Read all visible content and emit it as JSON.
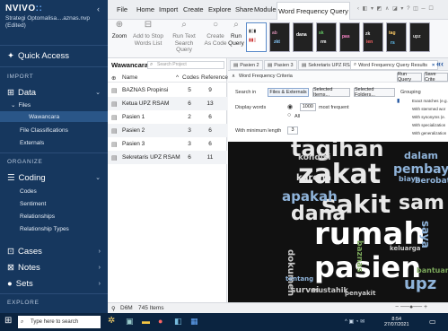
{
  "sidebar": {
    "logo": "NVIVO",
    "logo_mark": "::",
    "project": "Strategi Optomalisa....aznas.nvp",
    "project_state": "(Edited)",
    "quick_access": "Quick Access",
    "import_heading": "IMPORT",
    "data": "Data",
    "files": "Files",
    "wawancara": "Wawancara",
    "file_classifications": "File Classifications",
    "externals": "Externals",
    "organize_heading": "ORGANIZE",
    "coding": "Coding",
    "codes": "Codes",
    "sentiment": "Sentiment",
    "relationships": "Relationships",
    "relationship_types": "Relationship Types",
    "cases": "Cases",
    "notes": "Notes",
    "sets": "Sets",
    "explore_heading": "EXPLORE"
  },
  "menu": [
    "File",
    "Home",
    "Import",
    "Create",
    "Explore",
    "Share",
    "Modules"
  ],
  "active_tab": "Word Frequency Query",
  "ribbon": {
    "zoom": "Zoom",
    "add_stop": [
      "Add to Stop",
      "Words List"
    ],
    "run_text": [
      "Run Text",
      "Search Query"
    ],
    "create_code": [
      "Create",
      "As Code"
    ],
    "run_query": [
      "Run",
      "Query"
    ]
  },
  "list": {
    "title": "Wawancara",
    "search_placeholder": "Search Project",
    "col_name": "Name",
    "col_codes": "Codes",
    "col_refs": "References",
    "rows": [
      {
        "name": "BAZNAS Propinsi",
        "codes": "5",
        "refs": "9"
      },
      {
        "name": "Ketua UPZ RSAM",
        "codes": "6",
        "refs": "13"
      },
      {
        "name": "Pasien 1",
        "codes": "2",
        "refs": "6"
      },
      {
        "name": "Pasien 2",
        "codes": "3",
        "refs": "6"
      },
      {
        "name": "Pasien 3",
        "codes": "3",
        "refs": "6"
      },
      {
        "name": "Sekretaris UPZ RSAM",
        "codes": "6",
        "refs": "11"
      }
    ]
  },
  "status": {
    "user": "D6M",
    "items": "745 Items"
  },
  "doc_tabs": [
    "Pasien 2",
    "Pasien 3",
    "Sekretaris UPZ RSAM",
    "Word Frequency Query Results"
  ],
  "criteria": {
    "title": "Word Frequency Criteria",
    "run_query": "Run Query",
    "save_crit": "Save Crite",
    "search_in": "Search in",
    "files_ext": "Files & Externals",
    "selected_items": "Selected Items...",
    "selected_folders": "Selected Folders...",
    "display_words": "Display words",
    "count": "1000",
    "most_frequent": "most frequent",
    "all": "All",
    "min_length_label": "With minimum length",
    "min_length": "3",
    "grouping": "Grouping",
    "group_opts": [
      "Exact matches (e.g.",
      "With stemmed wor",
      "With synonyms (e.",
      "With specialization",
      "With generalization"
    ]
  },
  "cloud_words": [
    {
      "t": "tagihan",
      "c": "#e8e8e8"
    },
    {
      "t": "zakat",
      "c": "#e8e8e8"
    },
    {
      "t": "sakit",
      "c": "#e8e8e8"
    },
    {
      "t": "rumah",
      "c": "#ffffff"
    },
    {
      "t": "pasien",
      "c": "#ffffff"
    },
    {
      "t": "dana",
      "c": "#e8e8e8"
    },
    {
      "t": "apakah",
      "c": "#8fb3d9"
    },
    {
      "t": "pembayaran",
      "c": "#8fb3d9"
    },
    {
      "t": "sam",
      "c": "#e8e8e8"
    },
    {
      "t": "karena",
      "c": "#e8e8e8"
    },
    {
      "t": "kondisi",
      "c": "#c9c9c9"
    },
    {
      "t": "dalam",
      "c": "#8fb3d9"
    },
    {
      "t": "berobat",
      "c": "#8fb3d9"
    },
    {
      "t": "dokumen",
      "c": "#c9c9c9"
    },
    {
      "t": "upz",
      "c": "#8fb3d9"
    },
    {
      "t": "baznas",
      "c": "#7aa65a"
    },
    {
      "t": "saya",
      "c": "#8fb3d9"
    },
    {
      "t": "survei",
      "c": "#c9c9c9"
    },
    {
      "t": "bantuan",
      "c": "#7aa65a"
    },
    {
      "t": "mustahik",
      "c": "#c9c9c9"
    },
    {
      "t": "biaya",
      "c": "#8fb3d9"
    },
    {
      "t": "keluarga",
      "c": "#c9c9c9"
    },
    {
      "t": "tentang",
      "c": "#8fb3d9"
    },
    {
      "t": "penyakit",
      "c": "#c9c9c9"
    }
  ],
  "taskbar": {
    "search": "Type here to search",
    "time": "8:54",
    "date": "27/07/2021"
  }
}
